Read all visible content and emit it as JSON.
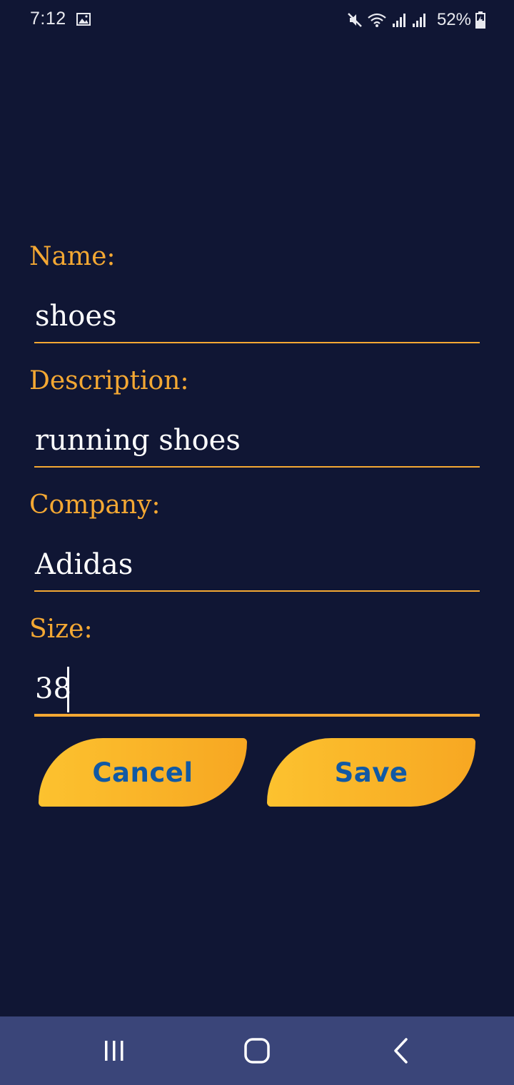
{
  "status_bar": {
    "time": "7:12",
    "battery_percent": "52%",
    "icons": [
      "gallery-icon",
      "mute-icon",
      "wifi-icon",
      "signal-icon",
      "signal-icon",
      "battery-charging-icon"
    ]
  },
  "form": {
    "fields": [
      {
        "label": "Name:",
        "value": "shoes"
      },
      {
        "label": "Description:",
        "value": "running shoes"
      },
      {
        "label": "Company:",
        "value": "Adidas"
      },
      {
        "label": "Size:",
        "value": "38"
      }
    ],
    "cancel_label": "Cancel",
    "save_label": "Save"
  },
  "nav_bar": {
    "buttons": [
      "recent-apps-icon",
      "home-icon",
      "back-icon"
    ]
  },
  "colors": {
    "background": "#101634",
    "accent": "#f4a833",
    "button_text": "#1159a4",
    "nav_bar": "#3a4579"
  }
}
